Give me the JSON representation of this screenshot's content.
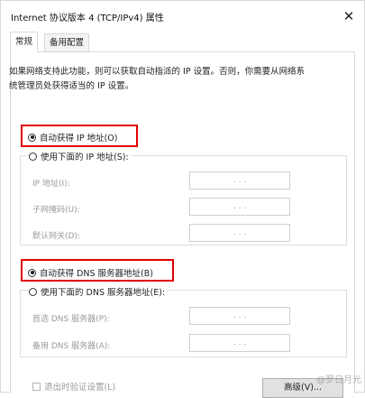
{
  "window": {
    "title": "Internet 协议版本 4 (TCP/IPv4) 属性",
    "close_glyph": "✕"
  },
  "tabs": [
    {
      "label": "常规",
      "active": true
    },
    {
      "label": "备用配置",
      "active": false
    }
  ],
  "description": "如果网络支持此功能，则可以获取自动指派的 IP 设置。否则，你需要从网络系统管理员处获得适当的 IP 设置。",
  "ip_section": {
    "auto_label": "自动获得 IP 地址(O)",
    "auto_checked": true,
    "manual_label": "使用下面的 IP 地址(S):",
    "manual_checked": false,
    "fields": [
      {
        "label": "IP 地址(I):",
        "value": ". . ."
      },
      {
        "label": "子网掩码(U):",
        "value": ". . ."
      },
      {
        "label": "默认网关(D):",
        "value": ". . ."
      }
    ]
  },
  "dns_section": {
    "auto_label": "自动获得 DNS 服务器地址(B)",
    "auto_checked": true,
    "manual_label": "使用下面的 DNS 服务器地址(E):",
    "manual_checked": false,
    "fields": [
      {
        "label": "首选 DNS 服务器(P):",
        "value": ". . ."
      },
      {
        "label": "备用 DNS 服务器(A):",
        "value": ". . ."
      }
    ]
  },
  "footer": {
    "validate_label": "退出时验证设置(L)",
    "advanced_label": "高级(V)..."
  },
  "watermark": "@罗日月光",
  "colors": {
    "highlight_border": "#e00000",
    "disabled_text": "#9a9a9a"
  }
}
